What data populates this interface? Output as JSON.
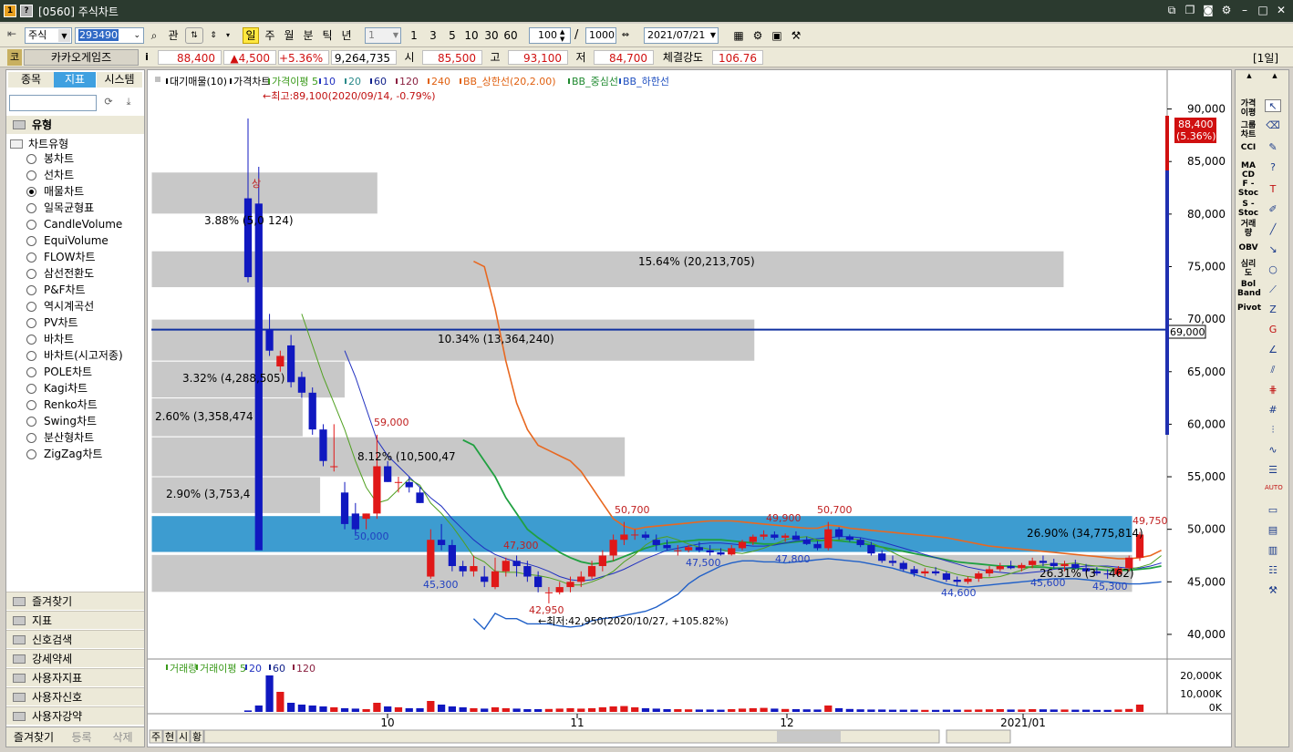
{
  "window": {
    "badge1": "1",
    "badge2": "?",
    "title": "[0560] 주식차트"
  },
  "toolbar": {
    "market": "주식",
    "code": "293490",
    "gwan": "관",
    "periods": [
      "일",
      "주",
      "월",
      "분",
      "틱",
      "년"
    ],
    "interval": "1",
    "quick": [
      "1",
      "3",
      "5",
      "10",
      "30",
      "60"
    ],
    "count": "100",
    "count_max": "1000",
    "date": "2021/07/21"
  },
  "quote": {
    "type": "코",
    "name": "카카오게임즈",
    "info": "i",
    "price": "88,400",
    "change": "▲4,500",
    "rate": "+5.36%",
    "volume": "9,264,735",
    "open_lbl": "시",
    "open": "85,500",
    "high_lbl": "고",
    "high": "93,100",
    "low_lbl": "저",
    "low": "84,700",
    "strength_lbl": "체결강도",
    "strength": "106.76",
    "period_badge": "[1일]"
  },
  "left": {
    "tabs": [
      "종목",
      "지표",
      "시스템"
    ],
    "section": "유형",
    "group": "차트유형",
    "items": [
      "봉차트",
      "선차트",
      "매물차트",
      "일목균형표",
      "CandleVolume",
      "EquiVolume",
      "FLOW차트",
      "삼선전환도",
      "P&F차트",
      "역시계곡선",
      "PV차트",
      "바차트",
      "바차트(시고저종)",
      "POLE차트",
      "Kagi차트",
      "Renko차트",
      "Swing차트",
      "분산형차트",
      "ZigZag차트"
    ],
    "folders": [
      "즐겨찾기",
      "지표",
      "신호검색",
      "강세약세",
      "사용자지표",
      "사용자신호",
      "사용자강약"
    ],
    "bottom": [
      "즐겨찾기",
      "등록",
      "삭제"
    ]
  },
  "chart": {
    "legend_items": [
      {
        "t": "대기매물(10)",
        "c": "#000000"
      },
      {
        "t": "가격차트",
        "c": "#000000"
      },
      {
        "t": "가격이평 5",
        "c": "#3a9a1a"
      },
      {
        "t": "10",
        "c": "#2030c0"
      },
      {
        "t": "20",
        "c": "#2a8a8a"
      },
      {
        "t": "60",
        "c": "#10208a"
      },
      {
        "t": "120",
        "c": "#8a2040"
      },
      {
        "t": "240",
        "c": "#e06010"
      },
      {
        "t": "BB_상한선(20,2.00)",
        "c": "#e06010"
      },
      {
        "t": "BB_중심선",
        "c": "#208a30"
      },
      {
        "t": "BB_하한선",
        "c": "#2050c0"
      }
    ],
    "high_note": "←최고:89,100(2020/09/14, -0.79%)",
    "low_note": "←최저:42,950(2020/10/27, +105.82%)",
    "price_tag": "88,400",
    "price_tag_pct": "(5.36%)",
    "line_tag": "69,000",
    "y_labels": [
      "90,000",
      "85,000",
      "80,000",
      "75,000",
      "70,000",
      "65,000",
      "60,000",
      "55,000",
      "50,000",
      "45,000",
      "40,000"
    ],
    "x_labels": [
      "10",
      "11",
      "12",
      "2021/01"
    ],
    "vol_legend": [
      {
        "t": "거래량",
        "c": "#3a9a1a"
      },
      {
        "t": "거래이평 5",
        "c": "#3a9a1a"
      },
      {
        "t": "20",
        "c": "#2030c0"
      },
      {
        "t": "60",
        "c": "#10208a"
      },
      {
        "t": "120",
        "c": "#8a2040"
      }
    ],
    "vol_y": [
      "20,000K",
      "10,000K",
      "0K"
    ],
    "tabs_bottom": [
      "주",
      "현",
      "시",
      "황"
    ],
    "annotations": [
      {
        "t": "59,000",
        "c": "#c02020"
      },
      {
        "t": "50,000",
        "c": "#2040c0"
      },
      {
        "t": "47,300",
        "c": "#c02020"
      },
      {
        "t": "45,300",
        "c": "#2040c0"
      },
      {
        "t": "42,950",
        "c": "#c02020"
      },
      {
        "t": "50,700",
        "c": "#c02020"
      },
      {
        "t": "47,500",
        "c": "#2040c0"
      },
      {
        "t": "49,900",
        "c": "#c02020"
      },
      {
        "t": "50,700",
        "c": "#c02020"
      },
      {
        "t": "47,800",
        "c": "#2040c0"
      },
      {
        "t": "44,600",
        "c": "#2040c0"
      },
      {
        "t": "45,600",
        "c": "#2040c0"
      },
      {
        "t": "45,300",
        "c": "#2040c0"
      },
      {
        "t": "49,750",
        "c": "#c02020"
      },
      {
        "t": "상",
        "c": "#c02020"
      }
    ],
    "profile_labels": [
      "3.88% (5,0",
      "124)",
      "15.64% (20,213,705)",
      "10.34% (13,364,240)",
      "3.32% (4,288,505)",
      "2.60% (3,358,474",
      "8.12% (10,500,47",
      "2.90% (3,753,4",
      "26.90% (34,775,814)",
      "26.31% (3",
      "462)"
    ]
  },
  "chart_data": {
    "type": "candlestick",
    "ylim": [
      38000,
      93000
    ],
    "volume_profile": [
      {
        "lo": 80000,
        "hi": 84000,
        "pct": 3.88
      },
      {
        "lo": 73000,
        "hi": 76500,
        "pct": 15.64
      },
      {
        "lo": 66000,
        "hi": 70000,
        "pct": 10.34
      },
      {
        "lo": 62500,
        "hi": 66000,
        "pct": 3.32
      },
      {
        "lo": 58800,
        "hi": 62500,
        "pct": 2.6
      },
      {
        "lo": 55000,
        "hi": 58800,
        "pct": 8.12
      },
      {
        "lo": 51500,
        "hi": 55000,
        "pct": 2.9
      },
      {
        "lo": 47800,
        "hi": 51300,
        "pct": 26.9
      },
      {
        "lo": 44000,
        "hi": 47600,
        "pct": 26.31
      }
    ],
    "candles": [
      [
        81500,
        89100,
        73500,
        74000
      ],
      [
        81000,
        84500,
        63500,
        48000
      ],
      [
        69000,
        70500,
        66500,
        67000
      ],
      [
        65500,
        67000,
        65000,
        66500
      ],
      [
        67500,
        68500,
        63500,
        64000
      ],
      [
        64500,
        65000,
        62500,
        63000
      ],
      [
        63000,
        63500,
        59000,
        59500
      ],
      [
        59500,
        60000,
        56000,
        56500
      ],
      [
        56000,
        60000,
        55500,
        56000
      ],
      [
        53500,
        54500,
        50000,
        50500
      ],
      [
        51500,
        52500,
        49500,
        50000
      ],
      [
        51000,
        51500,
        50000,
        51500
      ],
      [
        51500,
        59000,
        51000,
        56000
      ],
      [
        56000,
        56500,
        54500,
        54500
      ],
      [
        54500,
        55000,
        53500,
        54500
      ],
      [
        54500,
        55000,
        53500,
        54000
      ],
      [
        53500,
        54000,
        52500,
        52500
      ],
      [
        45500,
        50000,
        45300,
        49000
      ],
      [
        49000,
        50500,
        48000,
        48500
      ],
      [
        48500,
        49000,
        46000,
        46500
      ],
      [
        46500,
        47000,
        45500,
        46000
      ],
      [
        46000,
        47500,
        45500,
        46500
      ],
      [
        45500,
        46500,
        44500,
        45000
      ],
      [
        44500,
        47300,
        44300,
        46000
      ],
      [
        46000,
        47300,
        45500,
        47000
      ],
      [
        47000,
        47500,
        45500,
        46500
      ],
      [
        46500,
        47000,
        45000,
        45500
      ],
      [
        45500,
        46000,
        44000,
        44500
      ],
      [
        44000,
        44500,
        42950,
        44000
      ],
      [
        44000,
        45000,
        43800,
        44500
      ],
      [
        44500,
        45500,
        44000,
        45000
      ],
      [
        45000,
        46000,
        44500,
        45500
      ],
      [
        45500,
        47000,
        45300,
        46500
      ],
      [
        46500,
        48000,
        46000,
        47500
      ],
      [
        47500,
        49500,
        47000,
        49000
      ],
      [
        49000,
        50700,
        48500,
        49500
      ],
      [
        49500,
        50000,
        49000,
        49500
      ],
      [
        49500,
        49800,
        49000,
        49200
      ],
      [
        49000,
        49500,
        48000,
        48500
      ],
      [
        48500,
        49000,
        48000,
        48200
      ],
      [
        48000,
        48500,
        47500,
        48000
      ],
      [
        48000,
        48500,
        47800,
        48300
      ],
      [
        48300,
        48800,
        47800,
        48000
      ],
      [
        48000,
        48500,
        47500,
        47800
      ],
      [
        47800,
        48200,
        47500,
        47600
      ],
      [
        47600,
        48500,
        47500,
        48200
      ],
      [
        48200,
        49000,
        48000,
        48800
      ],
      [
        48800,
        49500,
        48500,
        49300
      ],
      [
        49300,
        49900,
        49000,
        49500
      ],
      [
        49500,
        49800,
        49000,
        49200
      ],
      [
        49200,
        49600,
        48800,
        49400
      ],
      [
        49400,
        49800,
        49000,
        49000
      ],
      [
        49000,
        49300,
        48500,
        48600
      ],
      [
        48600,
        48900,
        48000,
        48200
      ],
      [
        48200,
        50700,
        48000,
        50000
      ],
      [
        50000,
        50200,
        49000,
        49300
      ],
      [
        49300,
        49500,
        48800,
        49000
      ],
      [
        49000,
        49200,
        48300,
        48500
      ],
      [
        48500,
        48800,
        47500,
        47700
      ],
      [
        47700,
        48000,
        46800,
        47000
      ],
      [
        47000,
        47500,
        46500,
        46800
      ],
      [
        46800,
        47000,
        46000,
        46200
      ],
      [
        46200,
        46500,
        45500,
        45800
      ],
      [
        45800,
        46300,
        45500,
        46000
      ],
      [
        46000,
        46400,
        45600,
        45800
      ],
      [
        45800,
        46000,
        45000,
        45200
      ],
      [
        45200,
        45500,
        44600,
        45000
      ],
      [
        45000,
        45500,
        44800,
        45300
      ],
      [
        45300,
        46000,
        45000,
        45800
      ],
      [
        45800,
        46500,
        45500,
        46200
      ],
      [
        46200,
        46800,
        46000,
        46500
      ],
      [
        46500,
        47000,
        46200,
        46300
      ],
      [
        46300,
        46800,
        46000,
        46600
      ],
      [
        46600,
        47300,
        46300,
        47000
      ],
      [
        47000,
        47500,
        46500,
        46800
      ],
      [
        46800,
        47200,
        46300,
        46500
      ],
      [
        46500,
        47000,
        46000,
        46700
      ],
      [
        46700,
        47100,
        46200,
        46300
      ],
      [
        46300,
        46700,
        45800,
        46000
      ],
      [
        46000,
        46400,
        45600,
        45800
      ],
      [
        45800,
        46200,
        45300,
        45700
      ],
      [
        45700,
        46500,
        45500,
        46300
      ],
      [
        46300,
        47500,
        46000,
        47300
      ],
      [
        47300,
        49750,
        47000,
        49500
      ]
    ],
    "volume": [
      0.8,
      3.5,
      20,
      11,
      5,
      4,
      3.5,
      3,
      2.5,
      2,
      1.8,
      1.5,
      5,
      3,
      2.5,
      2,
      2,
      6,
      4,
      3,
      2.5,
      2,
      1.8,
      2.5,
      2,
      1.8,
      1.5,
      1.5,
      1.6,
      1.8,
      2,
      1.8,
      2,
      2.5,
      3,
      3.2,
      2.5,
      2,
      1.8,
      1.5,
      1.5,
      1.4,
      1.3,
      1.3,
      1.2,
      1.5,
      1.8,
      2,
      2.2,
      1.8,
      1.6,
      1.5,
      1.4,
      1.3,
      3.5,
      2,
      1.6,
      1.4,
      1.3,
      1.3,
      1.2,
      1.2,
      1.2,
      1.1,
      1.1,
      1.2,
      1.2,
      1.2,
      1.3,
      1.4,
      1.5,
      1.3,
      1.3,
      1.5,
      1.4,
      1.3,
      1.3,
      1.2,
      1.2,
      1.1,
      1.1,
      1.3,
      1.6,
      4
    ],
    "ma5": [
      null,
      null,
      null,
      null,
      null,
      70500,
      67500,
      64500,
      62000,
      59500,
      56500,
      54000,
      52500,
      52800,
      53800,
      54800,
      54200,
      52500,
      51500,
      50300,
      48900,
      47400,
      46900,
      46000,
      45900,
      45900,
      45700,
      45600,
      45400,
      45100,
      44700,
      44700,
      45000,
      45400,
      46000,
      46900,
      47600,
      48500,
      49100,
      49300,
      49000,
      48600,
      48300,
      48100,
      48100,
      47800,
      47700,
      47900,
      48200,
      48600,
      49000,
      49200,
      49300,
      49000,
      48900,
      49000,
      49100,
      49000,
      48700,
      48300,
      47800,
      47300,
      46900,
      46500,
      46300,
      46000,
      45700,
      45500,
      45400,
      45400,
      45500,
      45800,
      46100,
      46500,
      46600,
      46700,
      46700,
      46800,
      46600,
      46500,
      46400,
      46200,
      46200,
      46400,
      46700,
      47500
    ],
    "ma10": [
      null,
      null,
      null,
      null,
      null,
      null,
      null,
      null,
      null,
      67000,
      64500,
      61500,
      58500,
      57000,
      56000,
      55000,
      54000,
      53000,
      52200,
      51000,
      50000,
      49000,
      48200,
      47600,
      47200,
      46900,
      46700,
      46400,
      46000,
      45500,
      45200,
      45100,
      45200,
      45500,
      45800,
      46200,
      46700,
      47200,
      47600,
      48000,
      48200,
      48400,
      48600,
      48700,
      48700,
      48600,
      48500,
      48400,
      48400,
      48500,
      48700,
      48900,
      49000,
      49100,
      49200,
      49300,
      49300,
      49200,
      49000,
      48800,
      48500,
      48200,
      47900,
      47600,
      47300,
      47000,
      46700,
      46400,
      46200,
      46000,
      45900,
      45800,
      45800,
      45900,
      46000,
      46200,
      46300,
      46400,
      46500,
      46500,
      46500,
      46400,
      46300,
      46300,
      46500,
      46800
    ],
    "bb_upper": [
      null,
      null,
      null,
      null,
      null,
      null,
      null,
      null,
      null,
      null,
      null,
      null,
      null,
      null,
      null,
      null,
      null,
      null,
      null,
      null,
      null,
      75500,
      75000,
      71000,
      66000,
      62000,
      59500,
      58000,
      57500,
      57000,
      56500,
      55500,
      54000,
      52500,
      51000,
      50300,
      50000,
      50200,
      50300,
      50400,
      50500,
      50600,
      50700,
      50800,
      50800,
      50800,
      50700,
      50600,
      50500,
      50400,
      50300,
      50200,
      50100,
      50100,
      50400,
      50300,
      50100,
      50000,
      49900,
      49800,
      49700,
      49600,
      49500,
      49400,
      49300,
      49200,
      49000,
      48800,
      48600,
      48400,
      48300,
      48200,
      48100,
      48000,
      47900,
      47800,
      47700,
      47600,
      47500,
      47400,
      47300,
      47200,
      47200,
      47300,
      47500,
      48000
    ],
    "bb_mid": [
      null,
      null,
      null,
      null,
      null,
      null,
      null,
      null,
      null,
      null,
      null,
      null,
      null,
      null,
      null,
      null,
      null,
      null,
      null,
      null,
      58500,
      58000,
      56500,
      55000,
      53000,
      51500,
      50000,
      49200,
      48500,
      47800,
      47300,
      46900,
      46700,
      46800,
      47000,
      47400,
      47800,
      48200,
      48500,
      48700,
      48800,
      48900,
      49000,
      49000,
      49000,
      48900,
      48800,
      48700,
      48600,
      48600,
      48700,
      48800,
      48900,
      48900,
      49000,
      48900,
      48800,
      48700,
      48500,
      48300,
      48100,
      47900,
      47700,
      47500,
      47300,
      47100,
      46900,
      46800,
      46700,
      46600,
      46500,
      46500,
      46400,
      46400,
      46400,
      46300,
      46300,
      46300,
      46200,
      46200,
      46100,
      46100,
      46100,
      46200,
      46300,
      46500
    ],
    "bb_lower": [
      null,
      null,
      null,
      null,
      null,
      null,
      null,
      null,
      null,
      null,
      null,
      null,
      null,
      null,
      null,
      null,
      null,
      null,
      null,
      null,
      null,
      41500,
      40500,
      42000,
      41500,
      41500,
      41000,
      41000,
      41000,
      40800,
      40700,
      40800,
      41300,
      41500,
      41600,
      41800,
      42000,
      42200,
      42600,
      43200,
      43800,
      44800,
      45500,
      46000,
      46500,
      46800,
      47000,
      47000,
      46900,
      46900,
      46800,
      46900,
      47000,
      47100,
      47200,
      47100,
      47000,
      46900,
      46700,
      46500,
      46300,
      46000,
      45700,
      45400,
      45100,
      44800,
      44600,
      44500,
      44600,
      44700,
      44800,
      44900,
      45000,
      45100,
      45200,
      45300,
      45300,
      45300,
      45200,
      45100,
      45000,
      44900,
      44800,
      44800,
      44900,
      45000
    ],
    "hline": 69000,
    "price_marker": 88400
  }
}
